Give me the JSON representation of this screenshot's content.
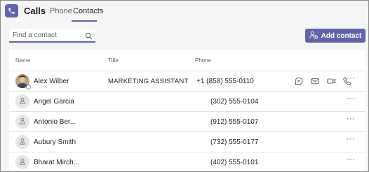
{
  "app": {
    "title": "Calls"
  },
  "tabs": [
    {
      "label": "Phone",
      "active": false
    },
    {
      "label": "Contacts",
      "active": true
    }
  ],
  "search": {
    "placeholder": "Find a contact",
    "value": ""
  },
  "add_button": {
    "label": "Add contact"
  },
  "columns": {
    "name": "Name",
    "title": "Title",
    "phone": "Phone"
  },
  "contacts": [
    {
      "name": "Alex Wilber",
      "title": "MARKETING ASSISTANT",
      "phone": "+1 (858) 555-0110",
      "avatar": "photo"
    },
    {
      "name": "Angel Garcia",
      "title": "",
      "phone": "(302) 555-0104",
      "avatar": "placeholder"
    },
    {
      "name": "Antonio Ber...",
      "title": "",
      "phone": "(912) 555-0107",
      "avatar": "placeholder"
    },
    {
      "name": "Aubury Smith",
      "title": "",
      "phone": "(732) 555-0177",
      "avatar": "placeholder"
    },
    {
      "name": "Bharat Mirch...",
      "title": "",
      "phone": "(402) 555-0101",
      "avatar": "placeholder"
    }
  ],
  "more_label": "···",
  "colors": {
    "accent": "#6264a7",
    "background": "#f5f5f5",
    "divider": "#e1e1e1"
  },
  "icons": [
    "phone-app-icon",
    "search-icon",
    "add-contact-icon",
    "chat-icon",
    "mail-icon",
    "video-icon",
    "call-icon",
    "more-options-icon",
    "person-placeholder-icon"
  ]
}
